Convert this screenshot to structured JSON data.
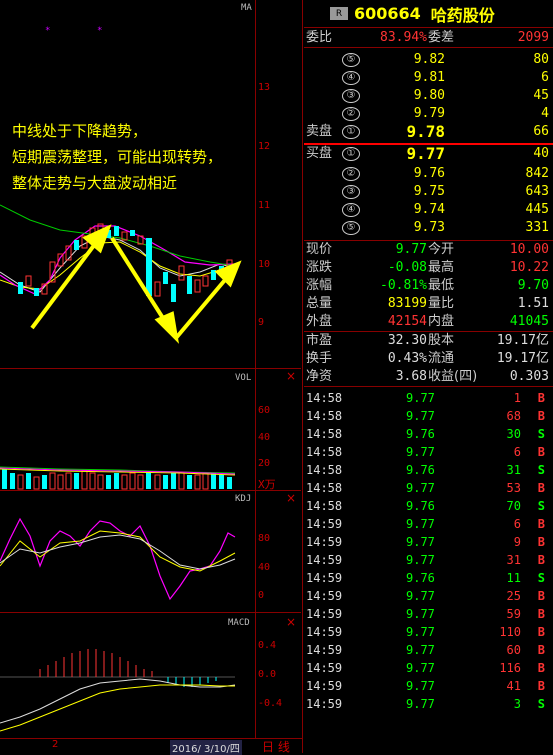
{
  "chart": {
    "main_label": "MA",
    "main_ticks": [
      "13",
      "12",
      "11",
      "10",
      "9"
    ],
    "annotation": [
      "中线处于下降趋势，",
      "短期震荡整理，可能出现转势，",
      "整体走势与大盘波动相近"
    ],
    "vol_label": "VOL",
    "vol_ticks": [
      "60",
      "40",
      "20"
    ],
    "vol_unit": "X万",
    "kdj_label": "KDJ",
    "kdj_ticks": [
      "80",
      "40",
      "0"
    ],
    "macd_label": "MACD",
    "macd_ticks": [
      "0.4",
      "0.0",
      "-0.4"
    ],
    "close_symbol": "×",
    "x_label": "2",
    "date": "2016/ 3/10/四",
    "period": "日 线"
  },
  "quote": {
    "badge": "R",
    "code": "600664",
    "name": "哈药股份",
    "wb_label": "委比",
    "wb_value": "83.94%",
    "wc_label": "委差",
    "wc_value": "2099",
    "sell_label": "卖盘",
    "buy_label": "买盘",
    "sell": [
      {
        "num": "⑤",
        "price": "9.82",
        "vol": "80"
      },
      {
        "num": "④",
        "price": "9.81",
        "vol": "6"
      },
      {
        "num": "③",
        "price": "9.80",
        "vol": "45"
      },
      {
        "num": "②",
        "price": "9.79",
        "vol": "4"
      },
      {
        "num": "①",
        "price": "9.78",
        "vol": "66"
      }
    ],
    "buy": [
      {
        "num": "①",
        "price": "9.77",
        "vol": "40"
      },
      {
        "num": "②",
        "price": "9.76",
        "vol": "842"
      },
      {
        "num": "③",
        "price": "9.75",
        "vol": "643"
      },
      {
        "num": "④",
        "price": "9.74",
        "vol": "445"
      },
      {
        "num": "⑤",
        "price": "9.73",
        "vol": "331"
      }
    ],
    "stats": [
      {
        "k1": "现价",
        "v1": "9.77",
        "c1": "green",
        "k2": "今开",
        "v2": "10.00",
        "c2": "red"
      },
      {
        "k1": "涨跌",
        "v1": "-0.08",
        "c1": "green",
        "k2": "最高",
        "v2": "10.22",
        "c2": "red"
      },
      {
        "k1": "涨幅",
        "v1": "-0.81%",
        "c1": "green",
        "k2": "最低",
        "v2": "9.70",
        "c2": "green"
      },
      {
        "k1": "总量",
        "v1": "83199",
        "c1": "yellow",
        "k2": "量比",
        "v2": "1.51",
        "c2": "white"
      },
      {
        "k1": "外盘",
        "v1": "42154",
        "c1": "red",
        "k2": "内盘",
        "v2": "41045",
        "c2": "green"
      }
    ],
    "fundamentals": [
      {
        "k1": "市盈",
        "v1": "32.30",
        "k2": "股本",
        "v2": "19.17亿"
      },
      {
        "k1": "换手",
        "v1": "0.43%",
        "k2": "流通",
        "v2": "19.17亿"
      },
      {
        "k1": "净资",
        "v1": "3.68",
        "k2": "收益(四)",
        "v2": "0.303"
      }
    ]
  },
  "trades": [
    {
      "time": "14:58",
      "price": "9.77",
      "vol": "1",
      "dir": "B",
      "color": "red"
    },
    {
      "time": "14:58",
      "price": "9.77",
      "vol": "68",
      "dir": "B",
      "color": "red"
    },
    {
      "time": "14:58",
      "price": "9.76",
      "vol": "30",
      "dir": "S",
      "color": "green"
    },
    {
      "time": "14:58",
      "price": "9.77",
      "vol": "6",
      "dir": "B",
      "color": "red"
    },
    {
      "time": "14:58",
      "price": "9.76",
      "vol": "31",
      "dir": "S",
      "color": "green"
    },
    {
      "time": "14:58",
      "price": "9.77",
      "vol": "53",
      "dir": "B",
      "color": "red"
    },
    {
      "time": "14:58",
      "price": "9.76",
      "vol": "70",
      "dir": "S",
      "color": "green"
    },
    {
      "time": "14:59",
      "price": "9.77",
      "vol": "6",
      "dir": "B",
      "color": "red"
    },
    {
      "time": "14:59",
      "price": "9.77",
      "vol": "9",
      "dir": "B",
      "color": "red"
    },
    {
      "time": "14:59",
      "price": "9.77",
      "vol": "31",
      "dir": "B",
      "color": "red"
    },
    {
      "time": "14:59",
      "price": "9.76",
      "vol": "11",
      "dir": "S",
      "color": "green"
    },
    {
      "time": "14:59",
      "price": "9.77",
      "vol": "25",
      "dir": "B",
      "color": "red"
    },
    {
      "time": "14:59",
      "price": "9.77",
      "vol": "59",
      "dir": "B",
      "color": "red"
    },
    {
      "time": "14:59",
      "price": "9.77",
      "vol": "110",
      "dir": "B",
      "color": "red"
    },
    {
      "time": "14:59",
      "price": "9.77",
      "vol": "60",
      "dir": "B",
      "color": "red"
    },
    {
      "time": "14:59",
      "price": "9.77",
      "vol": "116",
      "dir": "B",
      "color": "red"
    },
    {
      "time": "14:59",
      "price": "9.77",
      "vol": "41",
      "dir": "B",
      "color": "red"
    },
    {
      "time": "14:59",
      "price": "9.77",
      "vol": "3",
      "dir": "S",
      "color": "green"
    }
  ]
}
